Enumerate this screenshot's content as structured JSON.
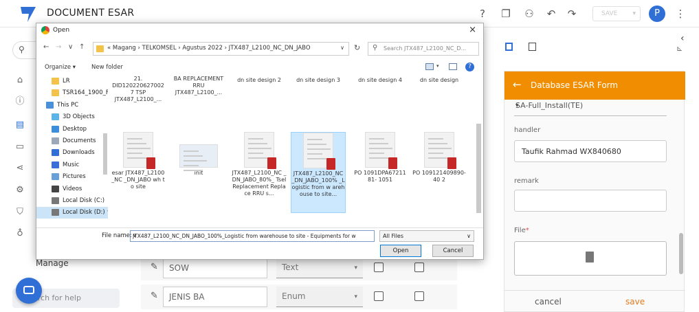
{
  "app": {
    "title": "DOCUMENT ESAR",
    "save_label": "SAVE",
    "avatar_letter": "P"
  },
  "nav": {
    "manage_label": "Manage",
    "search_help_placeholder": "arch for help"
  },
  "bg_rows": [
    {
      "name": "SOW",
      "type": "Text"
    },
    {
      "name": "JENIS BA",
      "type": "Enum"
    }
  ],
  "panel": {
    "header_title": "Database ESAR Form",
    "select_value": "SA-Full_Install(TE)",
    "handler_label": "handler",
    "handler_value": "Taufik Rahmad WX840680",
    "remark_label": "remark",
    "remark_value": "",
    "file_label": "File",
    "file_required": "*",
    "cancel_label": "cancel",
    "save_label": "save"
  },
  "dialog": {
    "title": "Open",
    "close": "×",
    "path": "« Magang  ›  TELKOMSEL  ›  Agustus 2022  ›  JTX487_L2100_NC_DN_JABO",
    "search_placeholder": "Search JTX487_L2100_NC_D...",
    "organize_label": "Organize ▾",
    "new_folder_label": "New folder",
    "help": "?",
    "tree": [
      {
        "label": "LR",
        "icon": "folder",
        "color": "#f3c24a",
        "indent": 1
      },
      {
        "label": "TSR164_1900_F",
        "icon": "folder",
        "color": "#f3c24a",
        "indent": 1
      },
      {
        "label": "This PC",
        "icon": "pc",
        "color": "#4a90d9",
        "indent": 0
      },
      {
        "label": "3D Objects",
        "icon": "3d",
        "color": "#5bb4e8",
        "indent": 1
      },
      {
        "label": "Desktop",
        "icon": "desktop",
        "color": "#3b8edb",
        "indent": 1
      },
      {
        "label": "Documents",
        "icon": "doc",
        "color": "#9aa8b8",
        "indent": 1
      },
      {
        "label": "Downloads",
        "icon": "down",
        "color": "#2f6fd6",
        "indent": 1
      },
      {
        "label": "Music",
        "icon": "music",
        "color": "#3a6ed8",
        "indent": 1
      },
      {
        "label": "Pictures",
        "icon": "pic",
        "color": "#6aa0d8",
        "indent": 1
      },
      {
        "label": "Videos",
        "icon": "video",
        "color": "#444",
        "indent": 1
      },
      {
        "label": "Local Disk (C:)",
        "icon": "disk",
        "color": "#777",
        "indent": 1
      },
      {
        "label": "Local Disk (D:) ∨",
        "icon": "disk",
        "color": "#777",
        "indent": 1,
        "selected": true
      }
    ],
    "top_files": [
      "21. DID120220627002 7 TSP JTX487_L2100_...",
      "BA REPLACEMENT RRU JTX487_L2100_...",
      "dn site design 2",
      "dn site design 3",
      "dn site design 4",
      "dn site design"
    ],
    "files": [
      {
        "name": "esar JTX487_L2100_NC _DN_JABO wh to site",
        "kind": "pdf"
      },
      {
        "name": "init",
        "kind": "img"
      },
      {
        "name": "JTX487_L2100_NC _DN_JABO_80%_ Tsel Replacement Replace RRU s...",
        "kind": "pdf"
      },
      {
        "name": "JTX487_L2100_NC _DN_JABO_100% _Logistic from w arehouse to site...",
        "kind": "pdf",
        "selected": true
      },
      {
        "name": "PO 1091DPA6721181- 1051",
        "kind": "pdf"
      },
      {
        "name": "PO 109121409890-40 2",
        "kind": "pdf"
      }
    ],
    "file_name_label": "File name:",
    "file_name_value": "JTX487_L2100_NC_DN_JABO_100%_Logistic from warehouse to site - Equipments for w",
    "filter_value": "All Files",
    "open_label": "Open",
    "cancel_label": "Cancel"
  },
  "colors": {
    "accent": "#2f6fd6",
    "panel_header": "#f18d00",
    "save_text": "#e07a1c"
  }
}
